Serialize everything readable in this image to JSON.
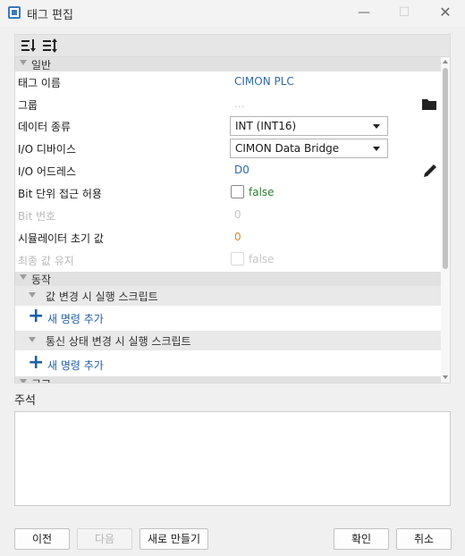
{
  "window": {
    "title": "태그 편집",
    "minimize": "—",
    "maximize": "☐",
    "close": "✕"
  },
  "toolbar": {
    "sort_icon": "sort-ascending-icon",
    "sort2_icon": "sort-list-icon"
  },
  "sections": {
    "general": "일반",
    "action": "동작",
    "next_partial": "구고"
  },
  "properties": {
    "tag_name": {
      "label": "태그 이름",
      "value": "CIMON PLC"
    },
    "group": {
      "label": "그룹",
      "value": "..."
    },
    "data_type": {
      "label": "데이터 종류",
      "value": "INT (INT16)"
    },
    "io_device": {
      "label": "I/O 디바이스",
      "value": "CIMON Data Bridge"
    },
    "io_address": {
      "label": "I/O 어드레스",
      "value": "D0"
    },
    "bit_access": {
      "label": "Bit 단위 접근 허용",
      "value": "false"
    },
    "bit_number": {
      "label": "Bit 번호",
      "value": "0"
    },
    "sim_initial": {
      "label": "시뮬레이터 초기 값",
      "value": "0"
    },
    "keep_last": {
      "label": "최종 값 유지",
      "value": "false"
    }
  },
  "action": {
    "on_change": {
      "label": "값 변경 시 실행 스크립트",
      "add": "새 명령 추가"
    },
    "on_comm": {
      "label": "통신 상태 변경 시 실행 스크립트",
      "add": "새 명령 추가"
    }
  },
  "comment": {
    "label": "주석"
  },
  "buttons": {
    "prev": "이전",
    "next": "다음",
    "new": "새로 만들기",
    "ok": "확인",
    "cancel": "취소"
  },
  "icons": {
    "folder": "folder-icon",
    "pencil": "pencil-icon",
    "add": "plus-icon"
  },
  "colors": {
    "link_blue": "#2d6aa8",
    "value_orange": "#d98a2b",
    "false_green": "#2c7d2c",
    "add_blue": "#1f5ea8"
  }
}
